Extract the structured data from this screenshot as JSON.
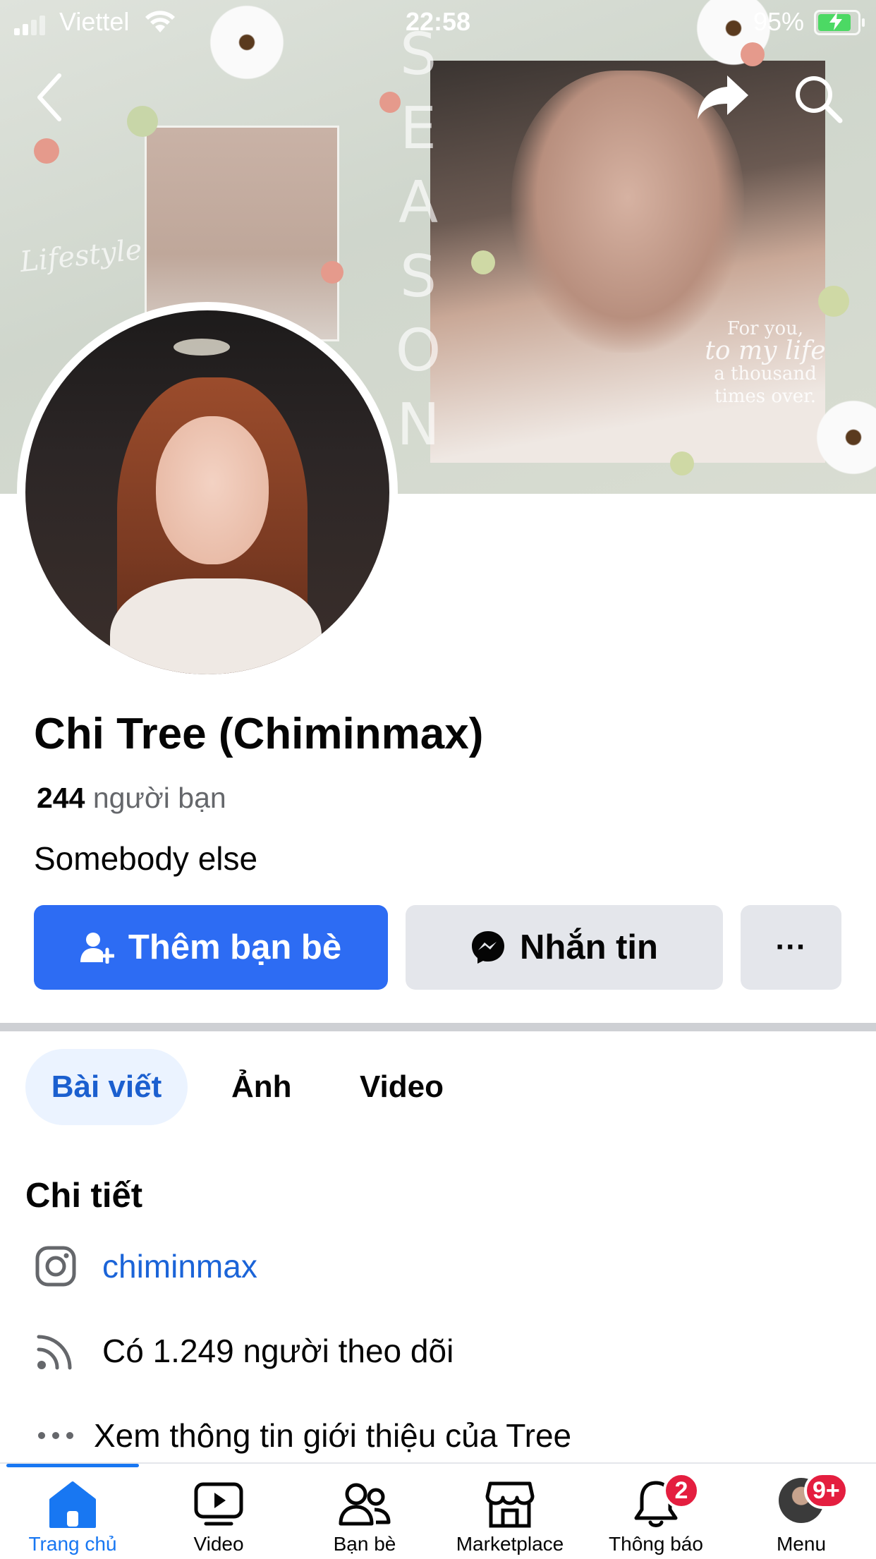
{
  "status_bar": {
    "carrier": "Viettel",
    "time": "22:58",
    "battery_percent": "95%",
    "battery_level": 0.95,
    "charging": true
  },
  "header": {
    "back_icon": "chevron-left-icon",
    "share_icon": "share-arrow-icon",
    "search_icon": "search-icon"
  },
  "cover": {
    "vertical_text": "SEASON",
    "script_text": "Lifestyle",
    "quote_line1": "For you,",
    "quote_line2": "to my life",
    "quote_line3": "a thousand",
    "quote_line4": "times over."
  },
  "profile": {
    "name": "Chi Tree (Chiminmax)",
    "friend_count": "244",
    "friend_label": "người bạn",
    "bio": "Somebody else"
  },
  "actions": {
    "add_friend_label": "Thêm bạn bè",
    "message_label": "Nhắn tin",
    "more_label": "···",
    "colors": {
      "primary": "#2d6cf3",
      "secondary": "#e4e6eb"
    }
  },
  "tabs": [
    {
      "label": "Bài viết",
      "active": true
    },
    {
      "label": "Ảnh",
      "active": false
    },
    {
      "label": "Video",
      "active": false
    }
  ],
  "details": {
    "title": "Chi tiết",
    "instagram": "chiminmax",
    "followers": "Có 1.249 người theo dõi",
    "about": "Xem thông tin giới thiệu của Tree"
  },
  "bottom_nav": {
    "items": [
      {
        "label": "Trang chủ",
        "icon": "home-icon",
        "active": true
      },
      {
        "label": "Video",
        "icon": "video-icon",
        "active": false
      },
      {
        "label": "Bạn bè",
        "icon": "friends-icon",
        "active": false
      },
      {
        "label": "Marketplace",
        "icon": "marketplace-icon",
        "active": false
      },
      {
        "label": "Thông báo",
        "icon": "bell-icon",
        "active": false,
        "badge": "2"
      },
      {
        "label": "Menu",
        "icon": "menu-avatar-icon",
        "active": false,
        "badge": "9+"
      }
    ],
    "accent": "#1877f2"
  }
}
